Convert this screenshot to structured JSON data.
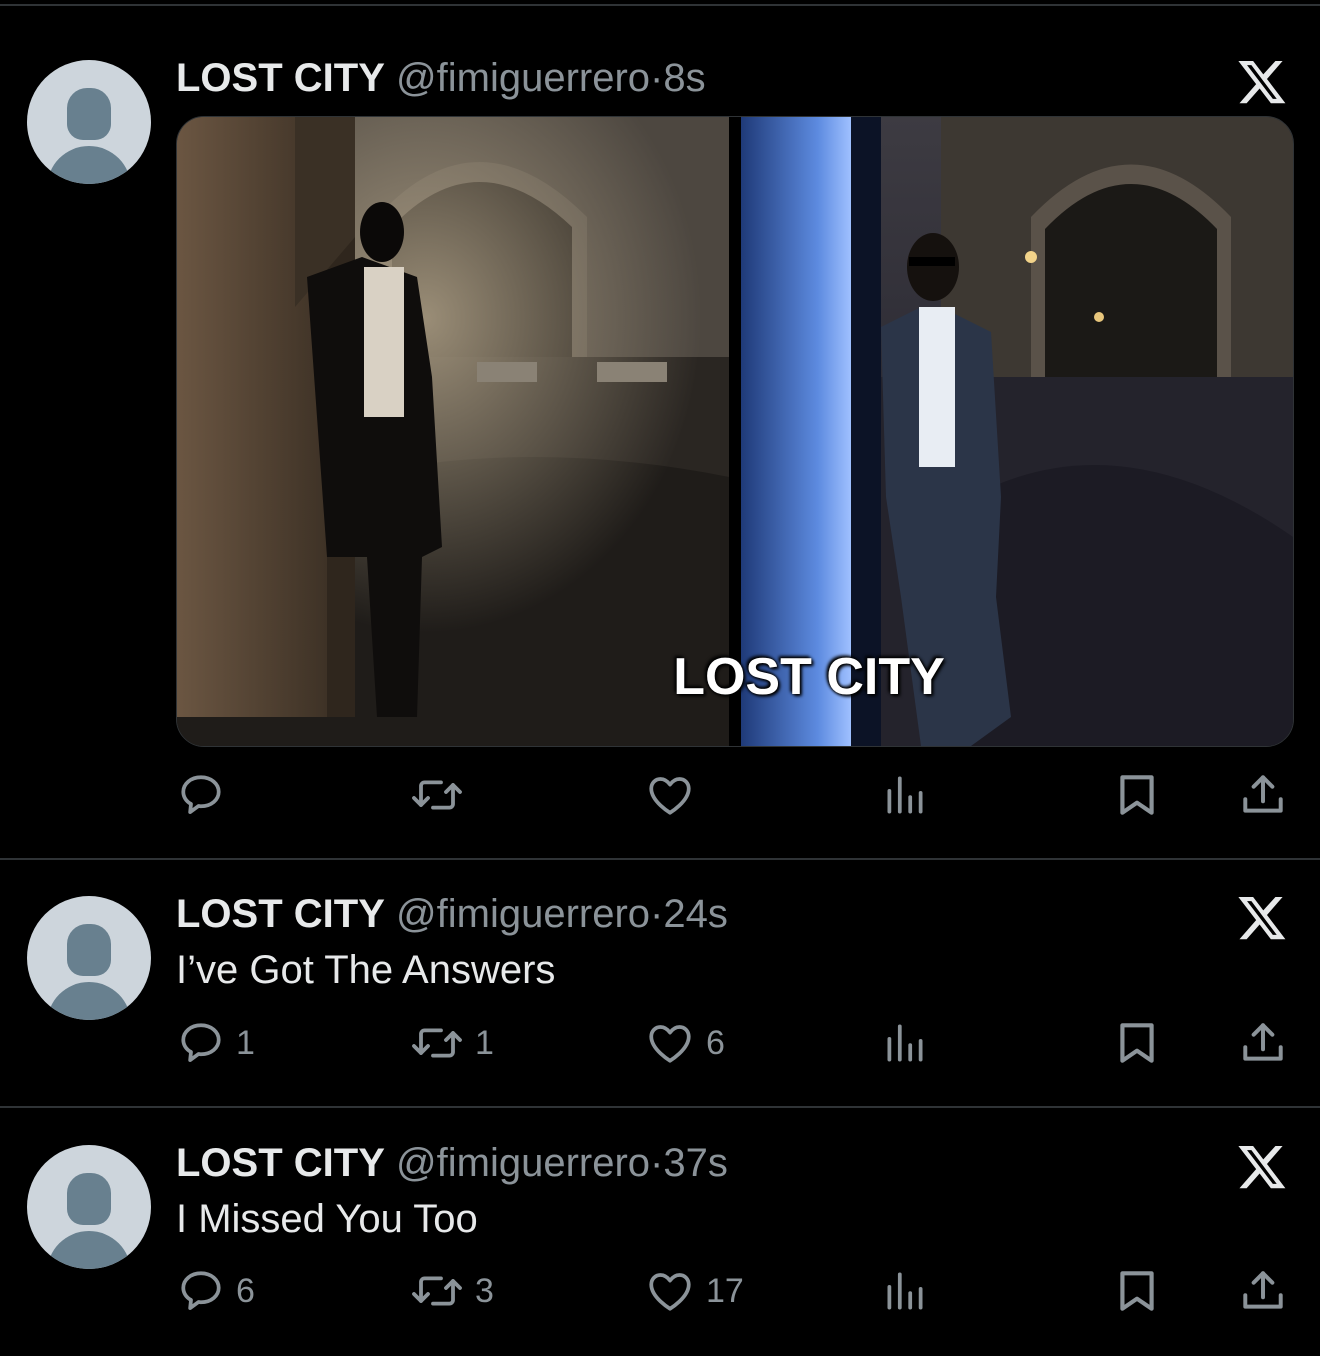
{
  "tweets": [
    {
      "name": "LOST CITY",
      "handle": "@fimiguerrero",
      "separator": "·",
      "time": "8s",
      "media_caption": "LOST CITY",
      "reply_count": "",
      "retweet_count": "",
      "like_count": ""
    },
    {
      "name": "LOST CITY",
      "handle": "@fimiguerrero",
      "separator": "·",
      "time": "24s",
      "text": "I’ve Got The Answers",
      "reply_count": "1",
      "retweet_count": "1",
      "like_count": "6"
    },
    {
      "name": "LOST CITY",
      "handle": "@fimiguerrero",
      "separator": "·",
      "time": "37s",
      "text": "I Missed You Too",
      "reply_count": "6",
      "retweet_count": "3",
      "like_count": "17"
    }
  ],
  "icons": {
    "reply": "speech-bubble-icon",
    "retweet": "retweet-arrows-icon",
    "like": "heart-icon",
    "views": "bar-chart-icon",
    "bookmark": "bookmark-icon",
    "share": "share-upload-icon",
    "brand": "x-logo-icon"
  },
  "colors": {
    "background": "#000000",
    "primary_text": "#e7e9ea",
    "secondary_text": "#8b9399",
    "divider": "#2f3336",
    "avatar_bg": "#cdd5dc",
    "avatar_fg": "#68808f"
  }
}
